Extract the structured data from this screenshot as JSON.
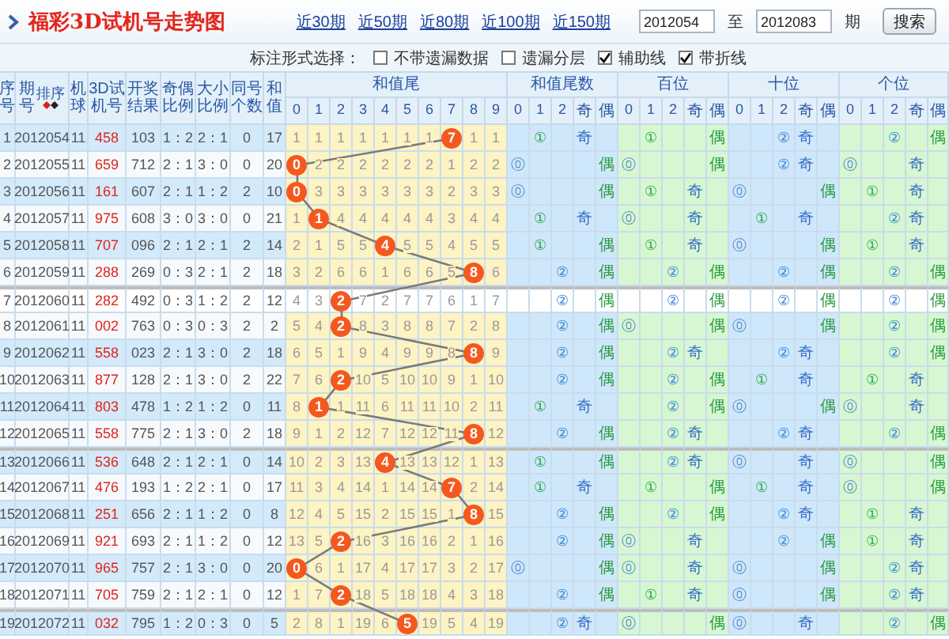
{
  "title": "福彩3D试机号走势图",
  "links": [
    "近30期",
    "近50期",
    "近80期",
    "近100期",
    "近150期"
  ],
  "range": {
    "from": "2012054",
    "separator": "至",
    "to": "2012083",
    "unit": "期"
  },
  "search_button": "搜索",
  "options": {
    "label": "标注形式选择：",
    "items": [
      {
        "label": "不带遗漏数据",
        "checked": false
      },
      {
        "label": "遗漏分层",
        "checked": false
      },
      {
        "label": "辅助线",
        "checked": true
      },
      {
        "label": "带折线",
        "checked": true
      }
    ]
  },
  "table": {
    "columns": [
      "序号",
      "期号",
      "机球",
      "3D试机号",
      "开奖结果",
      "奇偶比例",
      "大小比例",
      "同号个数",
      "和值"
    ],
    "sort_label": "排序",
    "groups": [
      {
        "label": "和值尾",
        "columns": [
          "0",
          "1",
          "2",
          "3",
          "4",
          "5",
          "6",
          "7",
          "8",
          "9"
        ]
      },
      {
        "label": "和值尾数",
        "columns": [
          "0",
          "1",
          "2",
          "奇",
          "偶"
        ]
      },
      {
        "label": "百位",
        "columns": [
          "0",
          "1",
          "2",
          "奇",
          "偶"
        ]
      },
      {
        "label": "十位",
        "columns": [
          "0",
          "1",
          "2",
          "奇",
          "偶"
        ]
      },
      {
        "label": "个位",
        "columns": [
          "0",
          "1",
          "2",
          "奇",
          "偶"
        ]
      }
    ],
    "rows": [
      {
        "no": "1",
        "period": "2012054",
        "machine": "11",
        "test": "458",
        "result": "103",
        "odd_even": "1：2",
        "big_small": "2：1",
        "same": "0",
        "sum": "17",
        "highlighted": false,
        "tail": [
          {
            "text": "1",
            "hit": false
          },
          {
            "text": "1",
            "hit": false
          },
          {
            "text": "1",
            "hit": false
          },
          {
            "text": "1",
            "hit": false
          },
          {
            "text": "1",
            "hit": false
          },
          {
            "text": "1",
            "hit": false
          },
          {
            "text": "1",
            "hit": false
          },
          {
            "text": "7",
            "hit": true
          },
          {
            "text": "1",
            "hit": false
          },
          {
            "text": "1",
            "hit": false
          }
        ],
        "stats": [
          [
            {
              "kind": "one",
              "text": "①"
            },
            {
              "kind": "odd",
              "text": "奇"
            }
          ],
          [
            {
              "kind": "one",
              "text": "①"
            },
            {
              "kind": "even",
              "text": "偶"
            }
          ],
          [
            {
              "kind": "two",
              "text": "②"
            },
            {
              "kind": "odd",
              "text": "奇"
            }
          ],
          [
            {
              "kind": "two",
              "text": "②"
            },
            {
              "kind": "even",
              "text": "偶"
            }
          ]
        ]
      },
      {
        "no": "2",
        "period": "2012055",
        "machine": "11",
        "test": "659",
        "result": "712",
        "odd_even": "2：1",
        "big_small": "3：0",
        "same": "0",
        "sum": "20",
        "highlighted": false,
        "tail": [
          {
            "text": "0",
            "hit": true
          },
          {
            "text": "2",
            "hit": false
          },
          {
            "text": "2",
            "hit": false
          },
          {
            "text": "2",
            "hit": false
          },
          {
            "text": "2",
            "hit": false
          },
          {
            "text": "2",
            "hit": false
          },
          {
            "text": "2",
            "hit": false
          },
          {
            "text": "1",
            "hit": false
          },
          {
            "text": "2",
            "hit": false
          },
          {
            "text": "2",
            "hit": false
          }
        ],
        "stats": [
          [
            {
              "kind": "zero",
              "text": "⓪"
            },
            {
              "kind": "even",
              "text": "偶"
            }
          ],
          [
            {
              "kind": "zero",
              "text": "⓪"
            },
            {
              "kind": "even",
              "text": "偶"
            }
          ],
          [
            {
              "kind": "two",
              "text": "②"
            },
            {
              "kind": "odd",
              "text": "奇"
            }
          ],
          [
            {
              "kind": "zero",
              "text": "⓪"
            },
            {
              "kind": "odd",
              "text": "奇"
            }
          ]
        ]
      },
      {
        "no": "3",
        "period": "2012056",
        "machine": "11",
        "test": "161",
        "result": "607",
        "odd_even": "2：1",
        "big_small": "1：2",
        "same": "2",
        "sum": "10",
        "highlighted": false,
        "tail": [
          {
            "text": "0",
            "hit": true
          },
          {
            "text": "3",
            "hit": false
          },
          {
            "text": "3",
            "hit": false
          },
          {
            "text": "3",
            "hit": false
          },
          {
            "text": "3",
            "hit": false
          },
          {
            "text": "3",
            "hit": false
          },
          {
            "text": "3",
            "hit": false
          },
          {
            "text": "2",
            "hit": false
          },
          {
            "text": "3",
            "hit": false
          },
          {
            "text": "3",
            "hit": false
          }
        ],
        "stats": [
          [
            {
              "kind": "zero",
              "text": "⓪"
            },
            {
              "kind": "even",
              "text": "偶"
            }
          ],
          [
            {
              "kind": "one",
              "text": "①"
            },
            {
              "kind": "odd",
              "text": "奇"
            }
          ],
          [
            {
              "kind": "zero",
              "text": "⓪"
            },
            {
              "kind": "even",
              "text": "偶"
            }
          ],
          [
            {
              "kind": "one",
              "text": "①"
            },
            {
              "kind": "odd",
              "text": "奇"
            }
          ]
        ]
      },
      {
        "no": "4",
        "period": "2012057",
        "machine": "11",
        "test": "975",
        "result": "608",
        "odd_even": "3：0",
        "big_small": "3：0",
        "same": "0",
        "sum": "21",
        "highlighted": false,
        "tail": [
          {
            "text": "1",
            "hit": false
          },
          {
            "text": "1",
            "hit": true
          },
          {
            "text": "4",
            "hit": false
          },
          {
            "text": "4",
            "hit": false
          },
          {
            "text": "4",
            "hit": false
          },
          {
            "text": "4",
            "hit": false
          },
          {
            "text": "4",
            "hit": false
          },
          {
            "text": "3",
            "hit": false
          },
          {
            "text": "4",
            "hit": false
          },
          {
            "text": "4",
            "hit": false
          }
        ],
        "stats": [
          [
            {
              "kind": "one",
              "text": "①"
            },
            {
              "kind": "odd",
              "text": "奇"
            }
          ],
          [
            {
              "kind": "zero",
              "text": "⓪"
            },
            {
              "kind": "odd",
              "text": "奇"
            }
          ],
          [
            {
              "kind": "one",
              "text": "①"
            },
            {
              "kind": "odd",
              "text": "奇"
            }
          ],
          [
            {
              "kind": "two",
              "text": "②"
            },
            {
              "kind": "odd",
              "text": "奇"
            }
          ]
        ]
      },
      {
        "no": "5",
        "period": "2012058",
        "machine": "11",
        "test": "707",
        "result": "096",
        "odd_even": "2：1",
        "big_small": "2：1",
        "same": "2",
        "sum": "14",
        "highlighted": false,
        "tail": [
          {
            "text": "2",
            "hit": false
          },
          {
            "text": "1",
            "hit": false
          },
          {
            "text": "5",
            "hit": false
          },
          {
            "text": "5",
            "hit": false
          },
          {
            "text": "4",
            "hit": true
          },
          {
            "text": "5",
            "hit": false
          },
          {
            "text": "5",
            "hit": false
          },
          {
            "text": "4",
            "hit": false
          },
          {
            "text": "5",
            "hit": false
          },
          {
            "text": "5",
            "hit": false
          }
        ],
        "stats": [
          [
            {
              "kind": "one",
              "text": "①"
            },
            {
              "kind": "even",
              "text": "偶"
            }
          ],
          [
            {
              "kind": "one",
              "text": "①"
            },
            {
              "kind": "odd",
              "text": "奇"
            }
          ],
          [
            {
              "kind": "zero",
              "text": "⓪"
            },
            {
              "kind": "even",
              "text": "偶"
            }
          ],
          [
            {
              "kind": "one",
              "text": "①"
            },
            {
              "kind": "odd",
              "text": "奇"
            }
          ]
        ]
      },
      {
        "no": "6",
        "period": "2012059",
        "machine": "11",
        "test": "288",
        "result": "269",
        "odd_even": "0：3",
        "big_small": "2：1",
        "same": "2",
        "sum": "18",
        "highlighted": false,
        "tail": [
          {
            "text": "3",
            "hit": false
          },
          {
            "text": "2",
            "hit": false
          },
          {
            "text": "6",
            "hit": false
          },
          {
            "text": "6",
            "hit": false
          },
          {
            "text": "1",
            "hit": false
          },
          {
            "text": "6",
            "hit": false
          },
          {
            "text": "6",
            "hit": false
          },
          {
            "text": "5",
            "hit": false
          },
          {
            "text": "8",
            "hit": true
          },
          {
            "text": "6",
            "hit": false
          }
        ],
        "stats": [
          [
            {
              "kind": "two",
              "text": "②"
            },
            {
              "kind": "even",
              "text": "偶"
            }
          ],
          [
            {
              "kind": "two",
              "text": "②"
            },
            {
              "kind": "even",
              "text": "偶"
            }
          ],
          [
            {
              "kind": "two",
              "text": "②"
            },
            {
              "kind": "even",
              "text": "偶"
            }
          ],
          [
            {
              "kind": "two",
              "text": "②"
            },
            {
              "kind": "even",
              "text": "偶"
            }
          ]
        ]
      },
      {
        "no": "7",
        "period": "2012060",
        "machine": "11",
        "test": "282",
        "result": "492",
        "odd_even": "0：3",
        "big_small": "1：2",
        "same": "2",
        "sum": "12",
        "highlighted": true,
        "tail": [
          {
            "text": "4",
            "hit": false
          },
          {
            "text": "3",
            "hit": false
          },
          {
            "text": "2",
            "hit": true
          },
          {
            "text": "7",
            "hit": false
          },
          {
            "text": "2",
            "hit": false
          },
          {
            "text": "7",
            "hit": false
          },
          {
            "text": "7",
            "hit": false
          },
          {
            "text": "6",
            "hit": false
          },
          {
            "text": "1",
            "hit": false
          },
          {
            "text": "7",
            "hit": false
          }
        ],
        "stats": [
          [
            {
              "kind": "two",
              "text": "②"
            },
            {
              "kind": "even",
              "text": "偶"
            }
          ],
          [
            {
              "kind": "two",
              "text": "②"
            },
            {
              "kind": "even",
              "text": "偶"
            }
          ],
          [
            {
              "kind": "two",
              "text": "②"
            },
            {
              "kind": "even",
              "text": "偶"
            }
          ],
          [
            {
              "kind": "two",
              "text": "②"
            },
            {
              "kind": "even",
              "text": "偶"
            }
          ]
        ]
      },
      {
        "no": "8",
        "period": "2012061",
        "machine": "11",
        "test": "002",
        "result": "763",
        "odd_even": "0：3",
        "big_small": "0：3",
        "same": "2",
        "sum": "2",
        "highlighted": false,
        "tail": [
          {
            "text": "5",
            "hit": false
          },
          {
            "text": "4",
            "hit": false
          },
          {
            "text": "2",
            "hit": true
          },
          {
            "text": "8",
            "hit": false
          },
          {
            "text": "3",
            "hit": false
          },
          {
            "text": "8",
            "hit": false
          },
          {
            "text": "8",
            "hit": false
          },
          {
            "text": "7",
            "hit": false
          },
          {
            "text": "2",
            "hit": false
          },
          {
            "text": "8",
            "hit": false
          }
        ],
        "stats": [
          [
            {
              "kind": "two",
              "text": "②"
            },
            {
              "kind": "even",
              "text": "偶"
            }
          ],
          [
            {
              "kind": "zero",
              "text": "⓪"
            },
            {
              "kind": "even",
              "text": "偶"
            }
          ],
          [
            {
              "kind": "zero",
              "text": "⓪"
            },
            {
              "kind": "even",
              "text": "偶"
            }
          ],
          [
            {
              "kind": "two",
              "text": "②"
            },
            {
              "kind": "even",
              "text": "偶"
            }
          ]
        ]
      },
      {
        "no": "9",
        "period": "2012062",
        "machine": "11",
        "test": "558",
        "result": "023",
        "odd_even": "2：1",
        "big_small": "3：0",
        "same": "2",
        "sum": "18",
        "highlighted": false,
        "tail": [
          {
            "text": "6",
            "hit": false
          },
          {
            "text": "5",
            "hit": false
          },
          {
            "text": "1",
            "hit": false
          },
          {
            "text": "9",
            "hit": false
          },
          {
            "text": "4",
            "hit": false
          },
          {
            "text": "9",
            "hit": false
          },
          {
            "text": "9",
            "hit": false
          },
          {
            "text": "8",
            "hit": false
          },
          {
            "text": "8",
            "hit": true
          },
          {
            "text": "9",
            "hit": false
          }
        ],
        "stats": [
          [
            {
              "kind": "two",
              "text": "②"
            },
            {
              "kind": "even",
              "text": "偶"
            }
          ],
          [
            {
              "kind": "two",
              "text": "②"
            },
            {
              "kind": "odd",
              "text": "奇"
            }
          ],
          [
            {
              "kind": "two",
              "text": "②"
            },
            {
              "kind": "odd",
              "text": "奇"
            }
          ],
          [
            {
              "kind": "two",
              "text": "②"
            },
            {
              "kind": "even",
              "text": "偶"
            }
          ]
        ]
      },
      {
        "no": "10",
        "period": "2012063",
        "machine": "11",
        "test": "877",
        "result": "128",
        "odd_even": "2：1",
        "big_small": "3：0",
        "same": "2",
        "sum": "22",
        "highlighted": false,
        "tail": [
          {
            "text": "7",
            "hit": false
          },
          {
            "text": "6",
            "hit": false
          },
          {
            "text": "2",
            "hit": true
          },
          {
            "text": "10",
            "hit": false
          },
          {
            "text": "5",
            "hit": false
          },
          {
            "text": "10",
            "hit": false
          },
          {
            "text": "10",
            "hit": false
          },
          {
            "text": "9",
            "hit": false
          },
          {
            "text": "1",
            "hit": false
          },
          {
            "text": "10",
            "hit": false
          }
        ],
        "stats": [
          [
            {
              "kind": "two",
              "text": "②"
            },
            {
              "kind": "even",
              "text": "偶"
            }
          ],
          [
            {
              "kind": "two",
              "text": "②"
            },
            {
              "kind": "even",
              "text": "偶"
            }
          ],
          [
            {
              "kind": "one",
              "text": "①"
            },
            {
              "kind": "odd",
              "text": "奇"
            }
          ],
          [
            {
              "kind": "one",
              "text": "①"
            },
            {
              "kind": "odd",
              "text": "奇"
            }
          ]
        ]
      },
      {
        "no": "11",
        "period": "2012064",
        "machine": "11",
        "test": "803",
        "result": "478",
        "odd_even": "1：2",
        "big_small": "1：2",
        "same": "0",
        "sum": "11",
        "highlighted": false,
        "tail": [
          {
            "text": "8",
            "hit": false
          },
          {
            "text": "1",
            "hit": true
          },
          {
            "text": "1",
            "hit": false
          },
          {
            "text": "11",
            "hit": false
          },
          {
            "text": "6",
            "hit": false
          },
          {
            "text": "11",
            "hit": false
          },
          {
            "text": "11",
            "hit": false
          },
          {
            "text": "10",
            "hit": false
          },
          {
            "text": "2",
            "hit": false
          },
          {
            "text": "11",
            "hit": false
          }
        ],
        "stats": [
          [
            {
              "kind": "one",
              "text": "①"
            },
            {
              "kind": "odd",
              "text": "奇"
            }
          ],
          [
            {
              "kind": "two",
              "text": "②"
            },
            {
              "kind": "even",
              "text": "偶"
            }
          ],
          [
            {
              "kind": "zero",
              "text": "⓪"
            },
            {
              "kind": "even",
              "text": "偶"
            }
          ],
          [
            {
              "kind": "zero",
              "text": "⓪"
            },
            {
              "kind": "odd",
              "text": "奇"
            }
          ]
        ]
      },
      {
        "no": "12",
        "period": "2012065",
        "machine": "11",
        "test": "558",
        "result": "775",
        "odd_even": "2：1",
        "big_small": "3：0",
        "same": "2",
        "sum": "18",
        "highlighted": false,
        "tail": [
          {
            "text": "9",
            "hit": false
          },
          {
            "text": "1",
            "hit": false
          },
          {
            "text": "2",
            "hit": false
          },
          {
            "text": "12",
            "hit": false
          },
          {
            "text": "7",
            "hit": false
          },
          {
            "text": "12",
            "hit": false
          },
          {
            "text": "12",
            "hit": false
          },
          {
            "text": "11",
            "hit": false
          },
          {
            "text": "8",
            "hit": true
          },
          {
            "text": "12",
            "hit": false
          }
        ],
        "stats": [
          [
            {
              "kind": "two",
              "text": "②"
            },
            {
              "kind": "even",
              "text": "偶"
            }
          ],
          [
            {
              "kind": "two",
              "text": "②"
            },
            {
              "kind": "odd",
              "text": "奇"
            }
          ],
          [
            {
              "kind": "two",
              "text": "②"
            },
            {
              "kind": "odd",
              "text": "奇"
            }
          ],
          [
            {
              "kind": "two",
              "text": "②"
            },
            {
              "kind": "even",
              "text": "偶"
            }
          ]
        ]
      },
      {
        "no": "13",
        "period": "2012066",
        "machine": "11",
        "test": "536",
        "result": "648",
        "odd_even": "2：1",
        "big_small": "2：1",
        "same": "0",
        "sum": "14",
        "highlighted": false,
        "tail": [
          {
            "text": "10",
            "hit": false
          },
          {
            "text": "2",
            "hit": false
          },
          {
            "text": "3",
            "hit": false
          },
          {
            "text": "13",
            "hit": false
          },
          {
            "text": "4",
            "hit": true
          },
          {
            "text": "13",
            "hit": false
          },
          {
            "text": "13",
            "hit": false
          },
          {
            "text": "12",
            "hit": false
          },
          {
            "text": "1",
            "hit": false
          },
          {
            "text": "13",
            "hit": false
          }
        ],
        "stats": [
          [
            {
              "kind": "one",
              "text": "①"
            },
            {
              "kind": "even",
              "text": "偶"
            }
          ],
          [
            {
              "kind": "two",
              "text": "②"
            },
            {
              "kind": "odd",
              "text": "奇"
            }
          ],
          [
            {
              "kind": "zero",
              "text": "⓪"
            },
            {
              "kind": "odd",
              "text": "奇"
            }
          ],
          [
            {
              "kind": "zero",
              "text": "⓪"
            },
            {
              "kind": "even",
              "text": "偶"
            }
          ]
        ]
      },
      {
        "no": "14",
        "period": "2012067",
        "machine": "11",
        "test": "476",
        "result": "193",
        "odd_even": "1：2",
        "big_small": "2：1",
        "same": "0",
        "sum": "17",
        "highlighted": false,
        "tail": [
          {
            "text": "11",
            "hit": false
          },
          {
            "text": "3",
            "hit": false
          },
          {
            "text": "4",
            "hit": false
          },
          {
            "text": "14",
            "hit": false
          },
          {
            "text": "1",
            "hit": false
          },
          {
            "text": "14",
            "hit": false
          },
          {
            "text": "14",
            "hit": false
          },
          {
            "text": "7",
            "hit": true
          },
          {
            "text": "2",
            "hit": false
          },
          {
            "text": "14",
            "hit": false
          }
        ],
        "stats": [
          [
            {
              "kind": "one",
              "text": "①"
            },
            {
              "kind": "odd",
              "text": "奇"
            }
          ],
          [
            {
              "kind": "one",
              "text": "①"
            },
            {
              "kind": "even",
              "text": "偶"
            }
          ],
          [
            {
              "kind": "one",
              "text": "①"
            },
            {
              "kind": "odd",
              "text": "奇"
            }
          ],
          [
            {
              "kind": "zero",
              "text": "⓪"
            },
            {
              "kind": "even",
              "text": "偶"
            }
          ]
        ]
      },
      {
        "no": "15",
        "period": "2012068",
        "machine": "11",
        "test": "251",
        "result": "656",
        "odd_even": "2：1",
        "big_small": "1：2",
        "same": "0",
        "sum": "8",
        "highlighted": false,
        "tail": [
          {
            "text": "12",
            "hit": false
          },
          {
            "text": "4",
            "hit": false
          },
          {
            "text": "5",
            "hit": false
          },
          {
            "text": "15",
            "hit": false
          },
          {
            "text": "2",
            "hit": false
          },
          {
            "text": "15",
            "hit": false
          },
          {
            "text": "15",
            "hit": false
          },
          {
            "text": "1",
            "hit": false
          },
          {
            "text": "8",
            "hit": true
          },
          {
            "text": "15",
            "hit": false
          }
        ],
        "stats": [
          [
            {
              "kind": "two",
              "text": "②"
            },
            {
              "kind": "even",
              "text": "偶"
            }
          ],
          [
            {
              "kind": "two",
              "text": "②"
            },
            {
              "kind": "even",
              "text": "偶"
            }
          ],
          [
            {
              "kind": "two",
              "text": "②"
            },
            {
              "kind": "odd",
              "text": "奇"
            }
          ],
          [
            {
              "kind": "one",
              "text": "①"
            },
            {
              "kind": "odd",
              "text": "奇"
            }
          ]
        ]
      },
      {
        "no": "16",
        "period": "2012069",
        "machine": "11",
        "test": "921",
        "result": "693",
        "odd_even": "2：1",
        "big_small": "1：2",
        "same": "0",
        "sum": "12",
        "highlighted": false,
        "tail": [
          {
            "text": "13",
            "hit": false
          },
          {
            "text": "5",
            "hit": false
          },
          {
            "text": "2",
            "hit": true
          },
          {
            "text": "16",
            "hit": false
          },
          {
            "text": "3",
            "hit": false
          },
          {
            "text": "16",
            "hit": false
          },
          {
            "text": "16",
            "hit": false
          },
          {
            "text": "2",
            "hit": false
          },
          {
            "text": "1",
            "hit": false
          },
          {
            "text": "16",
            "hit": false
          }
        ],
        "stats": [
          [
            {
              "kind": "two",
              "text": "②"
            },
            {
              "kind": "even",
              "text": "偶"
            }
          ],
          [
            {
              "kind": "zero",
              "text": "⓪"
            },
            {
              "kind": "odd",
              "text": "奇"
            }
          ],
          [
            {
              "kind": "two",
              "text": "②"
            },
            {
              "kind": "even",
              "text": "偶"
            }
          ],
          [
            {
              "kind": "one",
              "text": "①"
            },
            {
              "kind": "odd",
              "text": "奇"
            }
          ]
        ]
      },
      {
        "no": "17",
        "period": "2012070",
        "machine": "11",
        "test": "965",
        "result": "757",
        "odd_even": "2：1",
        "big_small": "3：0",
        "same": "0",
        "sum": "20",
        "highlighted": false,
        "tail": [
          {
            "text": "0",
            "hit": true
          },
          {
            "text": "6",
            "hit": false
          },
          {
            "text": "1",
            "hit": false
          },
          {
            "text": "17",
            "hit": false
          },
          {
            "text": "4",
            "hit": false
          },
          {
            "text": "17",
            "hit": false
          },
          {
            "text": "17",
            "hit": false
          },
          {
            "text": "3",
            "hit": false
          },
          {
            "text": "2",
            "hit": false
          },
          {
            "text": "17",
            "hit": false
          }
        ],
        "stats": [
          [
            {
              "kind": "zero",
              "text": "⓪"
            },
            {
              "kind": "even",
              "text": "偶"
            }
          ],
          [
            {
              "kind": "zero",
              "text": "⓪"
            },
            {
              "kind": "odd",
              "text": "奇"
            }
          ],
          [
            {
              "kind": "zero",
              "text": "⓪"
            },
            {
              "kind": "even",
              "text": "偶"
            }
          ],
          [
            {
              "kind": "two",
              "text": "②"
            },
            {
              "kind": "odd",
              "text": "奇"
            }
          ]
        ]
      },
      {
        "no": "18",
        "period": "2012071",
        "machine": "11",
        "test": "705",
        "result": "759",
        "odd_even": "2：1",
        "big_small": "2：1",
        "same": "0",
        "sum": "12",
        "highlighted": false,
        "tail": [
          {
            "text": "1",
            "hit": false
          },
          {
            "text": "7",
            "hit": false
          },
          {
            "text": "2",
            "hit": true
          },
          {
            "text": "18",
            "hit": false
          },
          {
            "text": "5",
            "hit": false
          },
          {
            "text": "18",
            "hit": false
          },
          {
            "text": "18",
            "hit": false
          },
          {
            "text": "4",
            "hit": false
          },
          {
            "text": "3",
            "hit": false
          },
          {
            "text": "18",
            "hit": false
          }
        ],
        "stats": [
          [
            {
              "kind": "two",
              "text": "②"
            },
            {
              "kind": "even",
              "text": "偶"
            }
          ],
          [
            {
              "kind": "one",
              "text": "①"
            },
            {
              "kind": "odd",
              "text": "奇"
            }
          ],
          [
            {
              "kind": "zero",
              "text": "⓪"
            },
            {
              "kind": "even",
              "text": "偶"
            }
          ],
          [
            {
              "kind": "two",
              "text": "②"
            },
            {
              "kind": "odd",
              "text": "奇"
            }
          ]
        ]
      },
      {
        "no": "19",
        "period": "2012072",
        "machine": "11",
        "test": "032",
        "result": "795",
        "odd_even": "1：2",
        "big_small": "0：3",
        "same": "0",
        "sum": "5",
        "highlighted": false,
        "tail": [
          {
            "text": "2",
            "hit": false
          },
          {
            "text": "8",
            "hit": false
          },
          {
            "text": "1",
            "hit": false
          },
          {
            "text": "19",
            "hit": false
          },
          {
            "text": "6",
            "hit": false
          },
          {
            "text": "5",
            "hit": true
          },
          {
            "text": "19",
            "hit": false
          },
          {
            "text": "5",
            "hit": false
          },
          {
            "text": "4",
            "hit": false
          },
          {
            "text": "19",
            "hit": false
          }
        ],
        "stats": [
          [
            {
              "kind": "two",
              "text": "②"
            },
            {
              "kind": "odd",
              "text": "奇"
            }
          ],
          [
            {
              "kind": "zero",
              "text": "⓪"
            },
            {
              "kind": "even",
              "text": "偶"
            }
          ],
          [
            {
              "kind": "zero",
              "text": "⓪"
            },
            {
              "kind": "odd",
              "text": "奇"
            }
          ],
          [
            {
              "kind": "two",
              "text": "②"
            },
            {
              "kind": "even",
              "text": "偶"
            }
          ]
        ]
      }
    ]
  }
}
